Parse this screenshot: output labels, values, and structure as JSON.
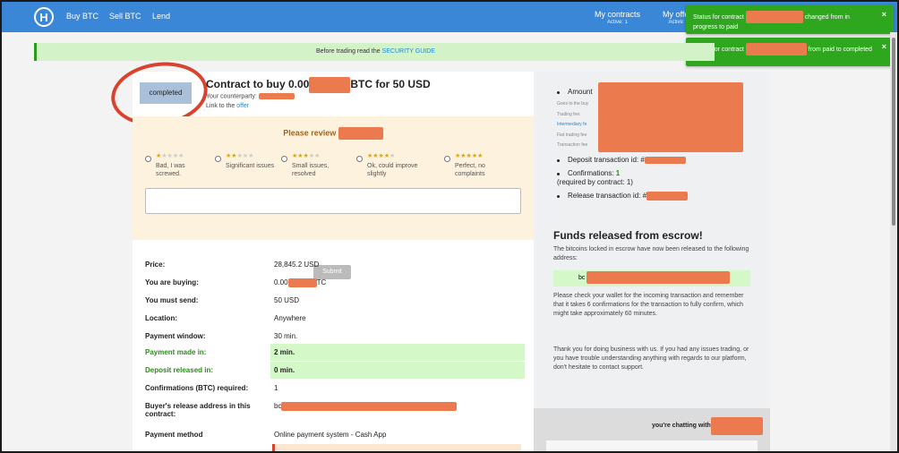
{
  "nav": {
    "buy": "Buy BTC",
    "sell": "Sell BTC",
    "lend": "Lend",
    "my_contracts": "My contracts",
    "my_contracts_sub": "Active: 1",
    "my_offers": "My offe",
    "my_offers_sub": "Active"
  },
  "toasts": [
    {
      "text_a": "Status for contract",
      "text_b": "changed from in progress to paid",
      "close": "×"
    },
    {
      "text_a": "Status for contract",
      "text_b": "from paid to completed",
      "close": "×"
    }
  ],
  "banner": {
    "prefix": "Before trading read the ",
    "link": "SECURITY GUIDE"
  },
  "contract": {
    "status": "completed",
    "title_a": "Contract to buy 0.00",
    "title_b": "BTC for 50 USD",
    "counterparty": "Your counterparty:",
    "link_prefix": "Link to the ",
    "link": "offer"
  },
  "review": {
    "title": "Please review",
    "options": [
      {
        "label": "Bad, I was screwed.",
        "stars": 1
      },
      {
        "label": "Significant issues",
        "stars": 2
      },
      {
        "label": "Small issues, resolved",
        "stars": 3
      },
      {
        "label": "Ok, could improve slightly",
        "stars": 4
      },
      {
        "label": "Perfect, no complaints",
        "stars": 5
      }
    ],
    "submit": "Submit"
  },
  "details": [
    {
      "k": "Price:",
      "v": "28,845.2 USD",
      "hl": false
    },
    {
      "k": "You are buying:",
      "v": "0.00",
      "v2": "TC",
      "hl": false
    },
    {
      "k": "You must send:",
      "v": "50 USD",
      "hl": false
    },
    {
      "k": "Location:",
      "v": "Anywhere",
      "hl": false
    },
    {
      "k": "Payment window:",
      "v": "30 min.",
      "hl": false
    },
    {
      "k": "Payment made in:",
      "v": "2  min.",
      "hl": true
    },
    {
      "k": "Deposit released in:",
      "v": "0  min.",
      "hl": true
    },
    {
      "k": "Confirmations (BTC) required:",
      "v": "1",
      "hl": false
    },
    {
      "k": "Buyer's release address in this",
      "k2": "contract:",
      "v": "bc",
      "hl": false
    },
    {
      "k": "Payment method",
      "v": "Online payment system - Cash App",
      "hl": false
    }
  ],
  "right": {
    "amount": "Amount",
    "tiny1": "Goes to the buy",
    "tiny2": "Trading fee:",
    "tiny3": "Intermediary fe",
    "tiny4": "Fiat trading fee",
    "tiny5": "Transaction fee",
    "deposit": "Deposit transaction id: #",
    "confirmations": "Confirmations: ",
    "confirmations_val": "1",
    "confirmations_req": "(required by contract: 1)",
    "release": "Release transaction id: #",
    "funds_title": "Funds released from escrow!",
    "funds_p1": "The bitcoins locked in escrow have now been released to the following address:",
    "addr_prefix": "bc",
    "funds_p2": "Please check your wallet for the incoming transaction and remember that it takes 6 confirmations for the transaction to fully confirm, which might take approximately 60 minutes.",
    "funds_p3": "Thank you for doing business with us. If you had any issues trading, or you have trouble understanding anything with regards to our platform, don't hesitate to contact support.",
    "chat_title": "you're chatting with"
  },
  "colors": {
    "nav": "#3a87d8",
    "toast": "#2ea61e",
    "redact": "#eb7a4e",
    "highlight": "#d4f8c8"
  }
}
